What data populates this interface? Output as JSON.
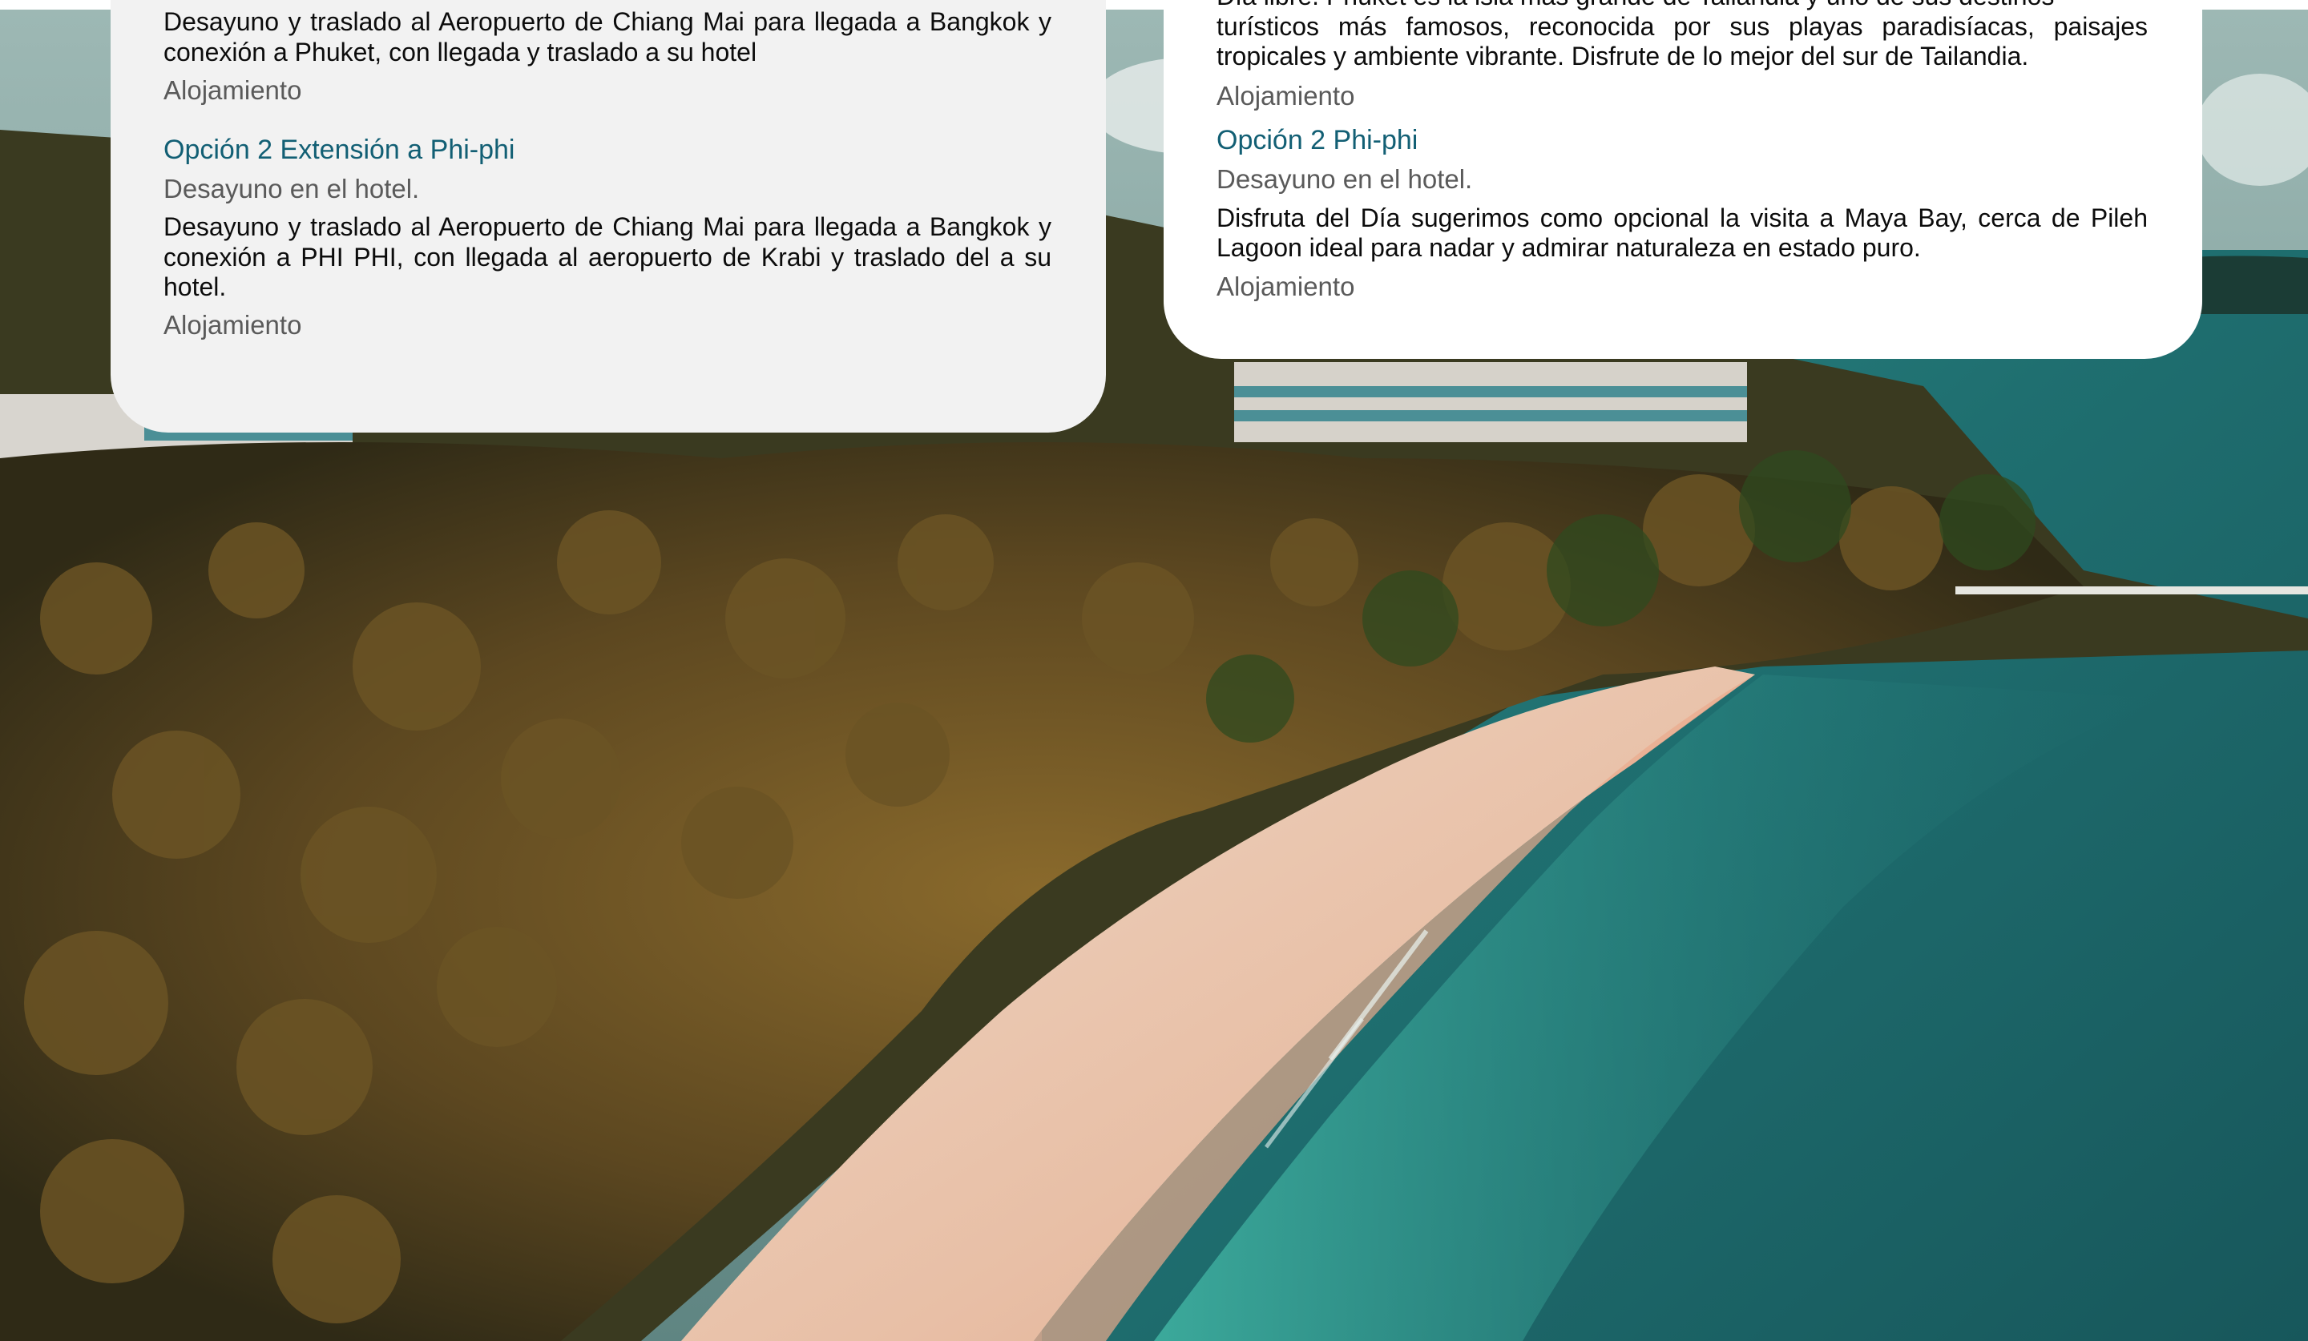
{
  "left_card": {
    "intro_text": "Desayuno y traslado al Aeropuerto de Chiang Mai para llegada a Bangkok y conexión a Phuket, con llegada y traslado a su hotel",
    "intro_lodging": "Alojamiento",
    "option_title": "Opción 2 Extensión a Phi-phi",
    "breakfast": "Desayuno en el hotel.",
    "option_text": "Desayuno y traslado al Aeropuerto de Chiang Mai para llegada a Bangkok y conexión a PHI PHI, con llegada al aeropuerto de Krabi y traslado del a su hotel.",
    "option_lodging": "Alojamiento"
  },
  "right_card": {
    "clipped_line": "Día libre. Phuket es la isla más grande de Tailandia y uno de sus destinos",
    "intro_text": "turísticos más famosos, reconocida por sus playas paradisíacas, paisajes tropicales y ambiente vibrante. Disfrute de lo mejor del sur de Tailandia.",
    "intro_lodging": "Alojamiento",
    "option_title": "Opción 2 Phi-phi",
    "breakfast": "Desayuno en el hotel.",
    "option_text": "Disfruta del Día sugerimos como opcional la visita a Maya Bay, cerca de Pileh Lagoon ideal para nadar y admirar naturaleza en estado puro.",
    "option_lodging": "Alojamiento"
  },
  "colors": {
    "option_title": "#125f74",
    "meta_text": "#5a5a5a",
    "body_text": "#0c0c0c",
    "left_card_bg": "#f2f2f2",
    "right_card_bg": "#ffffff",
    "sea": "#1f6b6d",
    "sand": "#e3b9a3",
    "palms": "#5b4a20"
  },
  "background_image": {
    "subject": "aerial-tropical-beach-photo"
  }
}
